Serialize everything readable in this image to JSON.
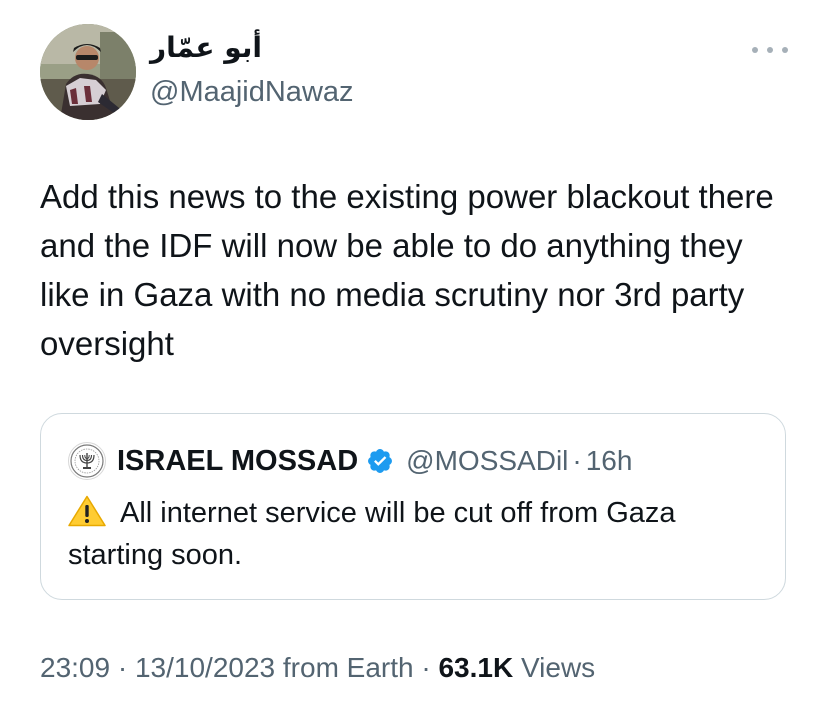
{
  "author": {
    "display_name": "أبو عمّار",
    "handle": "@MaajidNawaz",
    "avatar_icon": "profile-photo"
  },
  "menu": {
    "icon": "more-horizontal-icon"
  },
  "tweet": {
    "text": "Add this news to the existing power blackout there and the IDF will now be able to do anything they like in Gaza with no media scrutiny nor 3rd party oversight"
  },
  "quote": {
    "name": "ISRAEL MOSSAD",
    "verified_icon": "verified-badge-icon",
    "handle": "@MOSSADil",
    "separator": "·",
    "time": "16h",
    "warning_icon": "warning-icon",
    "text": "All internet service will be cut off from Gaza starting soon."
  },
  "meta": {
    "time": "23:09",
    "separator1": " · ",
    "date": "13/10/2023",
    "source": " from Earth",
    "separator2": " · ",
    "views_count": "63.1K",
    "views_label": " Views"
  },
  "colors": {
    "primary_text": "#0f1419",
    "secondary_text": "#536471",
    "border": "#cfd9de",
    "verified_blue": "#1d9bf0",
    "warning_yellow": "#ffcc32"
  }
}
